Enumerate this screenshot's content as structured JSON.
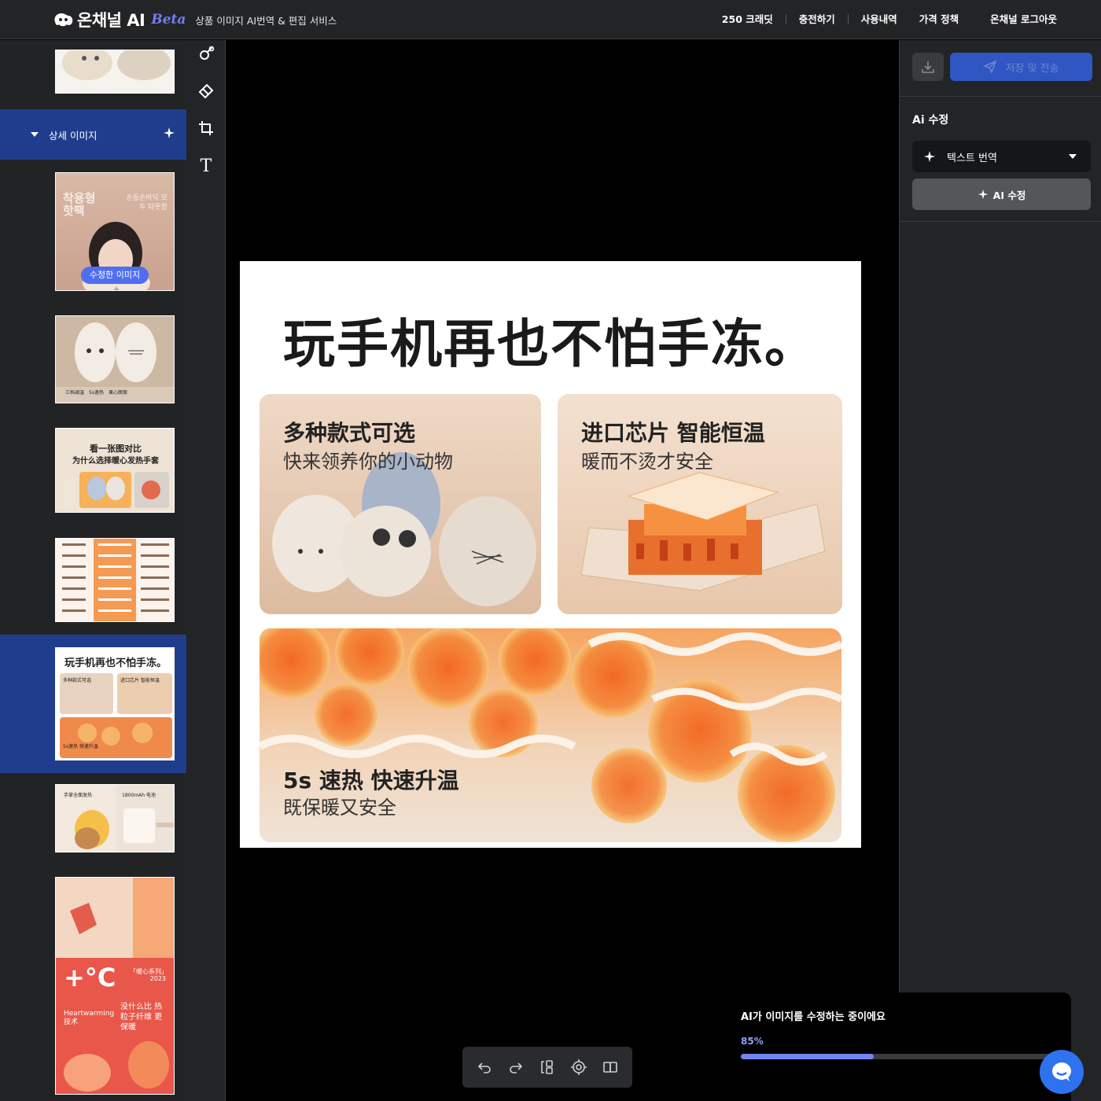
{
  "header": {
    "logo_text": "온채널 AI",
    "beta_label": "Beta",
    "subtitle": "상품 이미지 AI번역 & 편집 서비스",
    "nav": [
      {
        "label": "250 크래딧"
      },
      {
        "label": "충전하기"
      },
      {
        "label": "사용내역"
      },
      {
        "label": "가격 정책"
      },
      {
        "label": "온채널 로그아웃"
      }
    ]
  },
  "sidebar": {
    "section_label": "상세 이미지",
    "thumbnails": [
      {
        "texts": []
      },
      {
        "badge": "수정한 이미지",
        "texts": [
          "착용형 핫팩",
          "손등손바닥 모두 따뜻함"
        ]
      },
      {
        "texts": [
          "三档调温",
          "5s速热",
          "果心图案"
        ]
      },
      {
        "texts": [
          "看一张图对比",
          "为什么选择暖心发热手套"
        ]
      },
      {
        "texts": []
      },
      {
        "selected": true,
        "texts": [
          "玩手机再也不怕手冻。",
          "多种款式可选",
          "进口芯片 智能恒温",
          "5s速热 快速升温"
        ]
      },
      {
        "texts": [
          "手掌全面发热",
          "1800mAh 电池"
        ]
      },
      {
        "texts": [
          "+°C",
          "「暖心系列」",
          "2023",
          "Heartwarming 技术",
          "没什么比 热粒子纤维 更保暖"
        ]
      }
    ]
  },
  "tools": [
    {
      "name": "brush-tool-icon"
    },
    {
      "name": "eraser-tool-icon"
    },
    {
      "name": "crop-tool-icon"
    },
    {
      "name": "text-tool-icon",
      "glyph": "T"
    }
  ],
  "artboard": {
    "title": "玩手机再也不怕手冻。",
    "card1": {
      "line1": "多种款式可选",
      "line2": "快来领养你的小动物"
    },
    "card2": {
      "line1": "进口芯片 智能恒温",
      "line2": "暖而不烫才安全"
    },
    "card3": {
      "line1": "5s 速热 快速升温",
      "line2": "既保暖又安全"
    }
  },
  "bottom_toolbar": [
    "undo-icon",
    "redo-icon",
    "layers-icon",
    "target-icon",
    "compare-icon"
  ],
  "right_panel": {
    "send_label": "저장 및 전송",
    "section_title": "Ai 수정",
    "select_value": "텍스트 번역",
    "ai_button_label": "AI 수정"
  },
  "progress": {
    "message": "AI가 이미지를 수정하는 중이에요",
    "percent_label": "85%",
    "value": 0.85
  },
  "colors": {
    "accent": "#2f56c2",
    "selected_section": "#1f3d8c",
    "progress": "#6f86f0",
    "chat": "#2f72f0"
  }
}
